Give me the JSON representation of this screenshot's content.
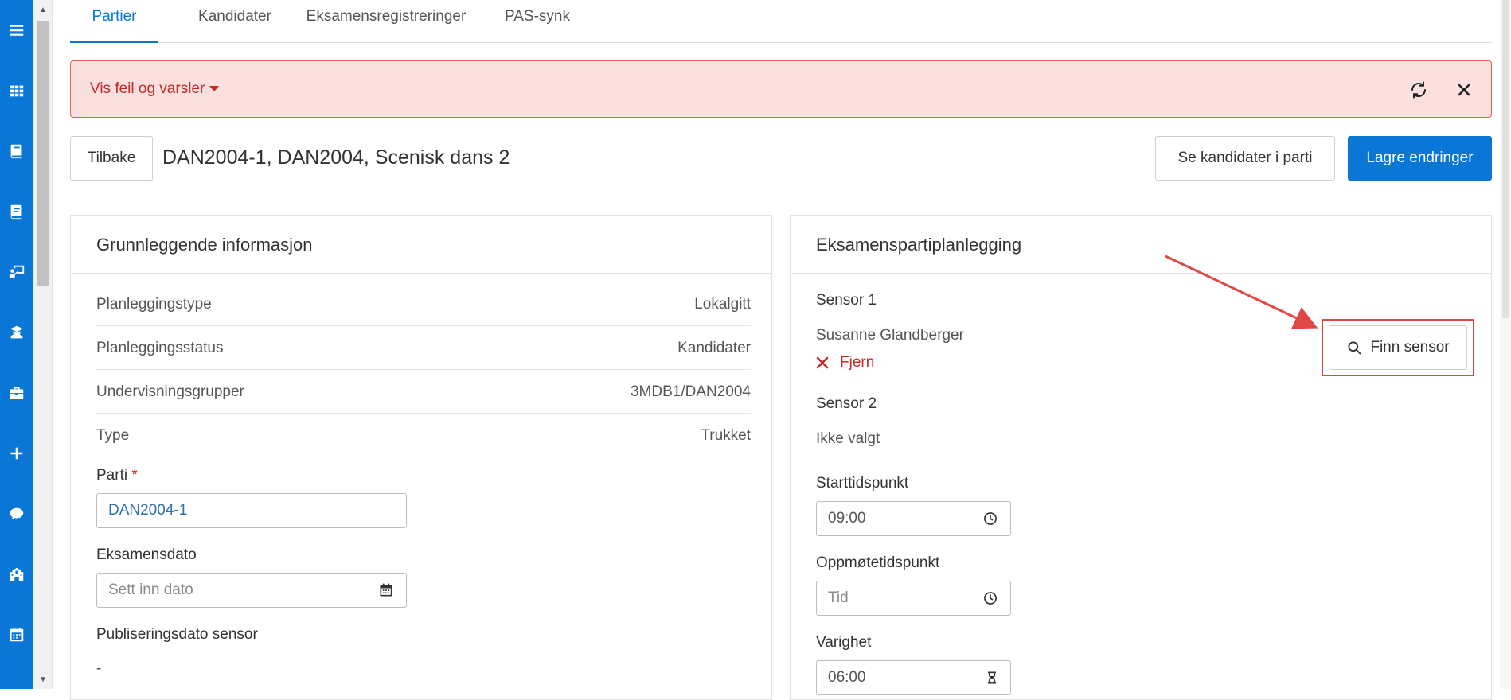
{
  "sidebar": {
    "icons": [
      "menu-icon",
      "apps-grid-icon",
      "book-icon",
      "book-alt-icon",
      "teacher-board-icon",
      "graduate-icon",
      "briefcase-icon",
      "plus-icon",
      "chat-icon",
      "school-building-icon",
      "calendar-icon"
    ]
  },
  "tabs": [
    {
      "label": "Partier",
      "active": true
    },
    {
      "label": "Kandidater",
      "active": false
    },
    {
      "label": "Eksamensregistreringer",
      "active": false
    },
    {
      "label": "PAS-synk",
      "active": false
    }
  ],
  "alert": {
    "label": "Vis feil og varsler",
    "bg_color": "#fbe0dd",
    "text_color": "#c62828"
  },
  "header": {
    "back_label": "Tilbake",
    "title": "DAN2004-1, DAN2004, Scenisk dans 2",
    "see_candidates_label": "Se kandidater i parti",
    "save_label": "Lagre endringer",
    "accent_color": "#0a76d6"
  },
  "basic_info": {
    "title": "Grunnleggende informasjon",
    "rows": [
      {
        "key": "Planleggingstype",
        "value": "Lokalgitt"
      },
      {
        "key": "Planleggingsstatus",
        "value": "Kandidater"
      },
      {
        "key": "Undervisningsgrupper",
        "value": "3MDB1/DAN2004"
      },
      {
        "key": "Type",
        "value": "Trukket"
      }
    ],
    "parti_label": "Parti",
    "parti_required": "*",
    "parti_value": "DAN2004-1",
    "exam_date_label": "Eksamensdato",
    "exam_date_placeholder": "Sett inn dato",
    "pub_date_label": "Publiseringsdato sensor",
    "pub_date_value": "-"
  },
  "planning": {
    "title": "Eksamenspartiplanlegging",
    "sensor1_label": "Sensor 1",
    "sensor1_name": "Susanne Glandberger",
    "remove_label": "Fjern",
    "find_sensor_label": "Finn sensor",
    "sensor2_label": "Sensor 2",
    "sensor2_value": "Ikke valgt",
    "start_label": "Starttidspunkt",
    "start_value": "09:00",
    "meet_label": "Oppmøtetidspunkt",
    "meet_placeholder": "Tid",
    "duration_label": "Varighet",
    "duration_value": "06:00"
  }
}
